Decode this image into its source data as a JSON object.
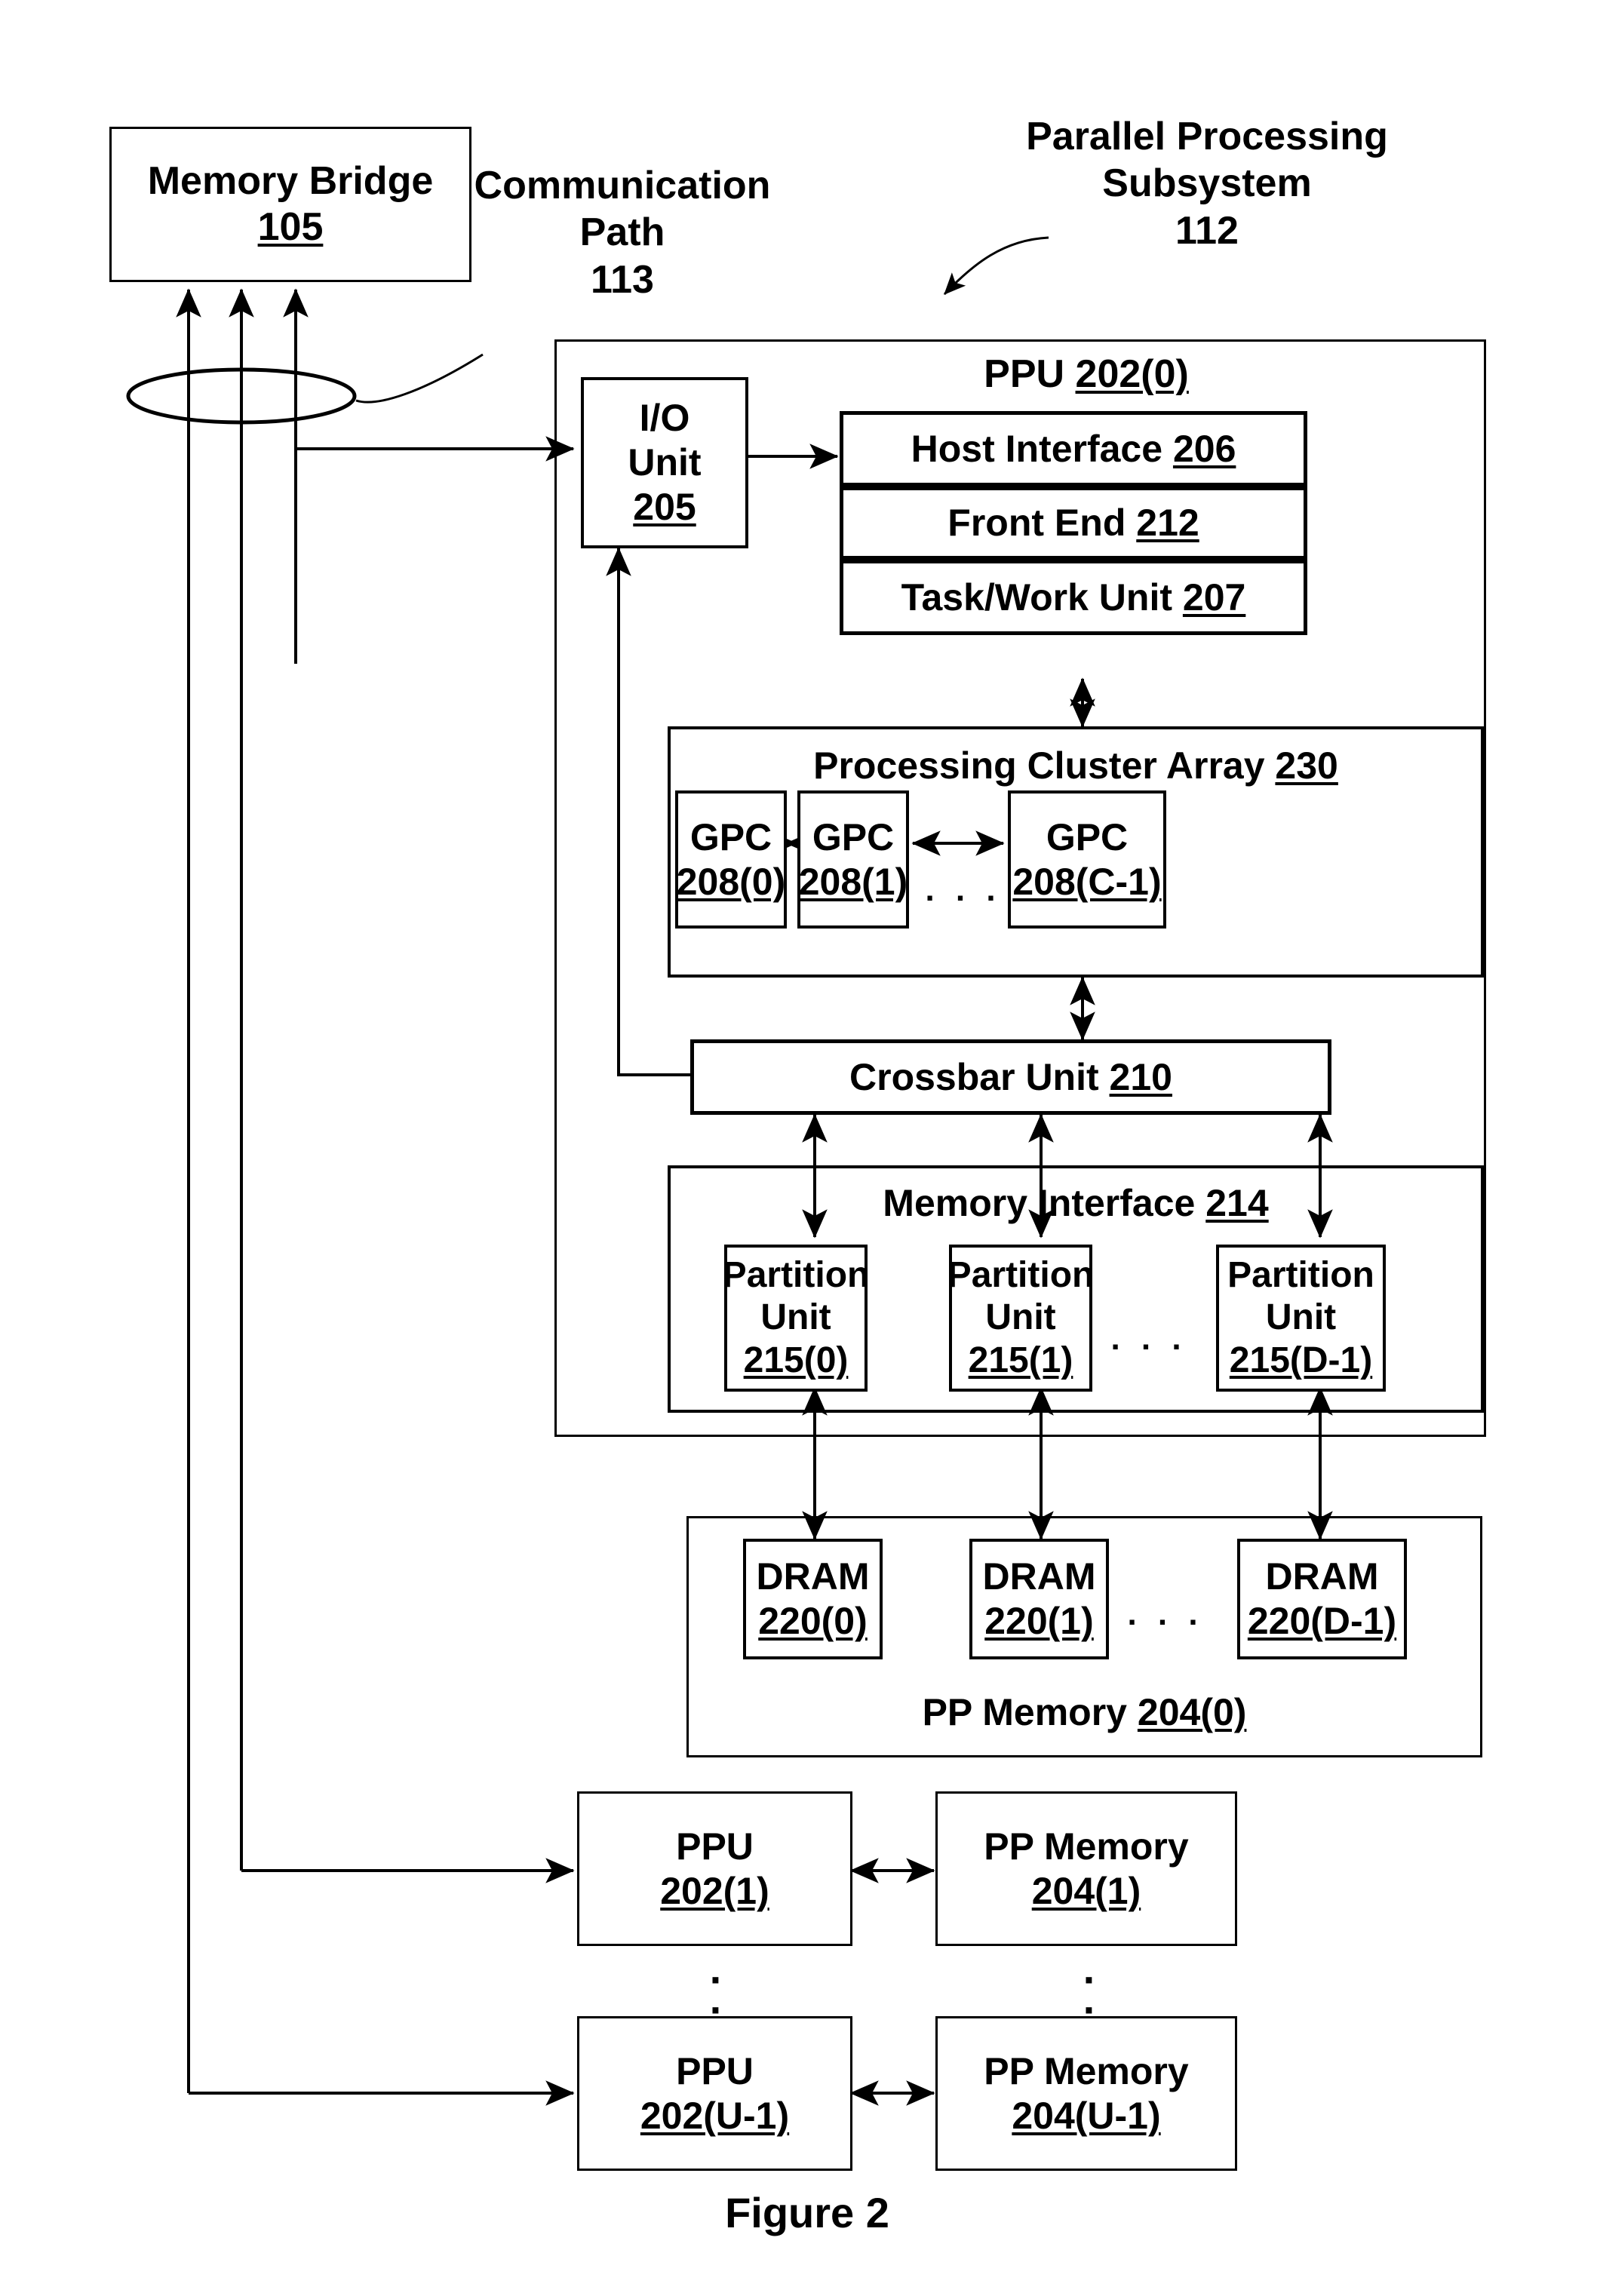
{
  "figure": {
    "caption": "Figure 2"
  },
  "annotations": {
    "comm_path": {
      "line1": "Communication",
      "line2": "Path",
      "ref": "113"
    },
    "subsystem": {
      "line1": "Parallel Processing",
      "line2": "Subsystem",
      "ref": "112"
    }
  },
  "memory_bridge": {
    "label": "Memory Bridge",
    "ref": "105"
  },
  "ppu0": {
    "title": "PPU",
    "ref": "202(0)",
    "io_unit": {
      "line1": "I/O",
      "line2": "Unit",
      "ref": "205"
    },
    "host_interface": {
      "label": "Host Interface",
      "ref": "206"
    },
    "front_end": {
      "label": "Front End",
      "ref": "212"
    },
    "task_work_unit": {
      "label": "Task/Work Unit",
      "ref": "207"
    },
    "cluster_array": {
      "label": "Processing Cluster Array",
      "ref": "230",
      "ellipsis": ". . .",
      "gpcs": [
        {
          "label": "GPC",
          "ref": "208(0)"
        },
        {
          "label": "GPC",
          "ref": "208(1)"
        },
        {
          "label": "GPC",
          "ref": "208(C-1)"
        }
      ]
    },
    "crossbar": {
      "label": "Crossbar Unit",
      "ref": "210"
    },
    "memory_interface": {
      "label": "Memory Interface",
      "ref": "214",
      "ellipsis": ". . .",
      "partitions": [
        {
          "line1": "Partition",
          "line2": "Unit",
          "ref": "215(0)"
        },
        {
          "line1": "Partition",
          "line2": "Unit",
          "ref": "215(1)"
        },
        {
          "line1": "Partition",
          "line2": "Unit",
          "ref": "215(D-1)"
        }
      ]
    }
  },
  "pp_memory0": {
    "label": "PP Memory",
    "ref": "204(0)",
    "ellipsis": ". . .",
    "drams": [
      {
        "label": "DRAM",
        "ref": "220(0)"
      },
      {
        "label": "DRAM",
        "ref": "220(1)"
      },
      {
        "label": "DRAM",
        "ref": "220(D-1)"
      }
    ]
  },
  "extra_units": {
    "vertical_ellipsis": "·\n·\n·",
    "rows": [
      {
        "ppu": {
          "label": "PPU",
          "ref": "202(1)"
        },
        "memory": {
          "label": "PP Memory",
          "ref": "204(1)"
        }
      },
      {
        "ppu": {
          "label": "PPU",
          "ref": "202(U-1)"
        },
        "memory": {
          "label": "PP Memory",
          "ref": "204(U-1)"
        }
      }
    ]
  },
  "colors": {
    "ink": "#000000",
    "paper": "#ffffff"
  }
}
